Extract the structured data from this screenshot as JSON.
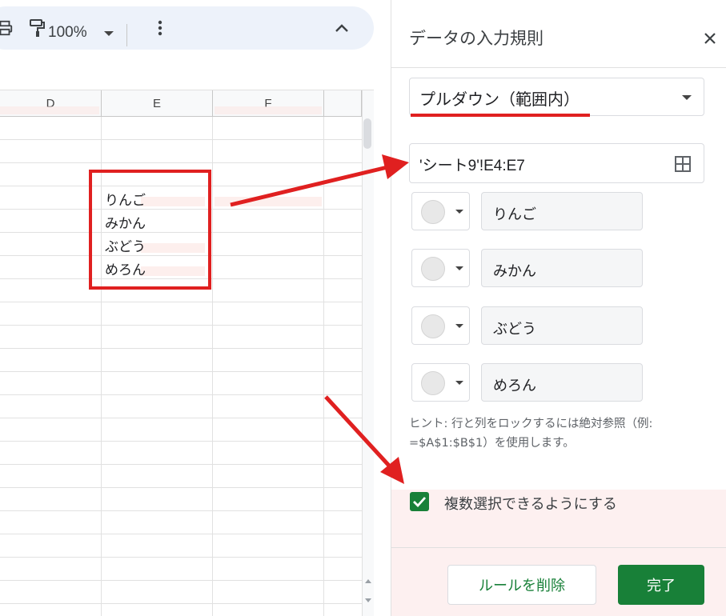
{
  "toolbar": {
    "zoom": "100%",
    "icons": [
      "print-icon",
      "paint-format-icon",
      "more-vert-icon",
      "chevron-up-icon"
    ]
  },
  "grid": {
    "columns": [
      "D",
      "E",
      "F"
    ],
    "cells": [
      "りんご",
      "みかん",
      "ぶどう",
      "めろん"
    ]
  },
  "panel": {
    "title": "データの入力規則",
    "criteria": "プルダウン（範囲内）",
    "range": "'シート9'!E4:E7",
    "options": [
      "りんご",
      "みかん",
      "ぶどう",
      "めろん"
    ],
    "hint": "ヒント: 行と列をロックするには絶対参照（例: =$A$1:$B$1）を使用します。",
    "multi_select_label": "複数選択できるようにする",
    "multi_select_checked": true,
    "remove_button": "ルールを削除",
    "done_button": "完了"
  },
  "colors": {
    "accent_green": "#188038",
    "annotation_red": "#e02020",
    "toolbar_bg": "#edf2fa"
  }
}
